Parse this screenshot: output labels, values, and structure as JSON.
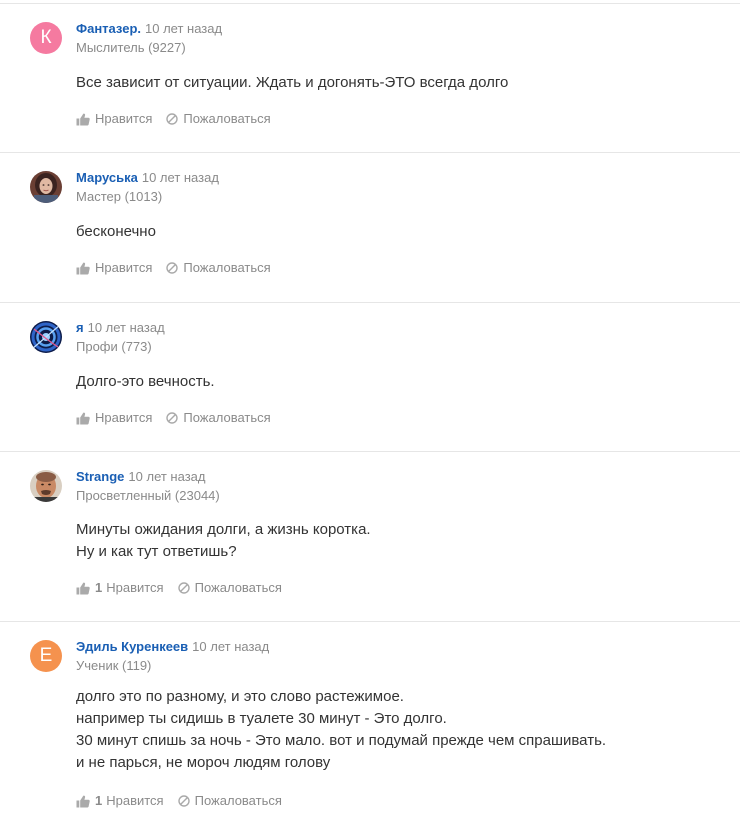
{
  "answers": [
    {
      "author": "Фантазер.",
      "time": "10 лет назад",
      "rank": "Мыслитель (9227)",
      "avatar": {
        "type": "letter",
        "letter": "К",
        "color": "#f57aa0"
      },
      "lines": [
        "Все зависит от ситуации. Ждать и догонять-ЭТО всегда долго"
      ],
      "like_count": "",
      "like_label": "Нравится",
      "report_label": "Пожаловаться"
    },
    {
      "author": "Маруська",
      "time": "10 лет назад",
      "rank": "Мастер (1013)",
      "avatar": {
        "type": "photo",
        "icon": "woman-portrait"
      },
      "lines": [
        "бесконечно"
      ],
      "like_count": "",
      "like_label": "Нравится",
      "report_label": "Пожаловаться"
    },
    {
      "author": "я",
      "time": "10 лет назад",
      "rank": "Профи (773)",
      "avatar": {
        "type": "photo",
        "icon": "blue-spiral"
      },
      "lines": [
        "Долго-это вечность."
      ],
      "like_count": "",
      "like_label": "Нравится",
      "report_label": "Пожаловаться"
    },
    {
      "author": "Strange",
      "time": "10 лет назад",
      "rank": "Просветленный (23044)",
      "avatar": {
        "type": "photo",
        "icon": "man-portrait"
      },
      "lines": [
        "Минуты ожидания долги, а жизнь коротка.",
        "Ну и как тут ответишь?"
      ],
      "like_count": "1",
      "like_label": "Нравится",
      "report_label": "Пожаловаться"
    },
    {
      "author": "Эдиль Куренкеев",
      "time": "10 лет назад",
      "rank": "Ученик (119)",
      "avatar": {
        "type": "letter",
        "letter": "Е",
        "color": "#f5924e"
      },
      "lines": [
        "долго это по разному, и это слово растежимое.",
        "например ты сидишь в туалете 30 минут - Это долго.",
        "30 минут спишь за ночь - Это мало. вот и подумай прежде чем спрашивать.",
        "и не парься, не мороч людям голову"
      ],
      "like_count": "1",
      "like_label": "Нравится",
      "report_label": "Пожаловаться"
    }
  ]
}
